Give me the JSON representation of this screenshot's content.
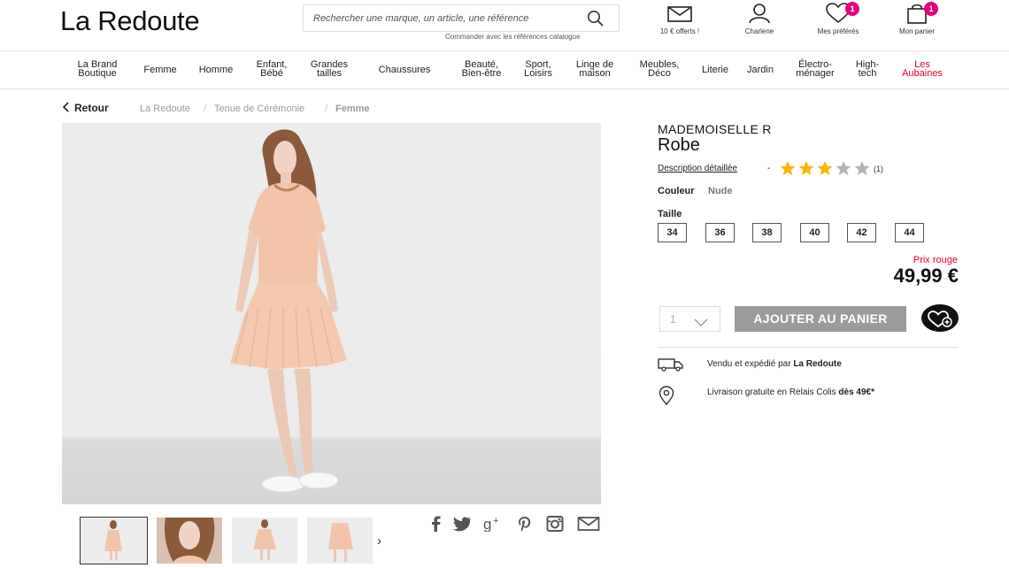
{
  "header": {
    "logo": "La Redoute",
    "search_placeholder": "Rechercher une marque, un article, une référence",
    "search_hint": "Commander avec les références catalogue",
    "offer_label": "10 € offerts !",
    "account_label": "Charlene",
    "favorites_label": "Mes préférés",
    "favorites_count": "1",
    "cart_label": "Mon panier",
    "cart_count": "1"
  },
  "nav": [
    "La Brand\nBoutique",
    "Femme",
    "Homme",
    "Enfant,\nBébé",
    "Grandes\ntailles",
    "Chaussures",
    "Beauté,\nBien-être",
    "Sport,\nLoisirs",
    "Linge de\nmaison",
    "Meubles,\nDéco",
    "Literie",
    "Jardin",
    "Électro-\nménager",
    "High-\ntech",
    "Les\nAubaines"
  ],
  "breadcrumb": {
    "back": "Retour",
    "items": [
      "La Redoute",
      "Tenue de Cérémonie",
      "Femme"
    ],
    "separator": "/"
  },
  "product": {
    "brand": "MADEMOISELLE R",
    "name": "Robe",
    "description_link": "Description détaillée",
    "dash": "-",
    "rating": 3,
    "rating_max": 5,
    "rating_count": "(1)",
    "color_label": "Couleur",
    "color_value": "Nude",
    "size_label": "Taille",
    "sizes": [
      "34",
      "36",
      "38",
      "40",
      "42",
      "44"
    ],
    "price_label": "Prix rouge",
    "price": "49,99 €",
    "quantity": "1",
    "add_to_cart": "AJOUTER AU PANIER",
    "shipping_prefix": "Vendu et expédié par ",
    "shipping_seller": "La Redoute",
    "delivery_prefix": "Livraison gratuite en Relais Colis ",
    "delivery_threshold": "dès 49€*"
  },
  "colors": {
    "brand_pink": "#e5007e",
    "red": "#e5002a",
    "star": "#f5b800",
    "button_gray": "#9b9b9b"
  },
  "share_icons": [
    "facebook-icon",
    "twitter-icon",
    "google-plus-icon",
    "pinterest-icon",
    "instagram-icon",
    "mail-icon"
  ]
}
